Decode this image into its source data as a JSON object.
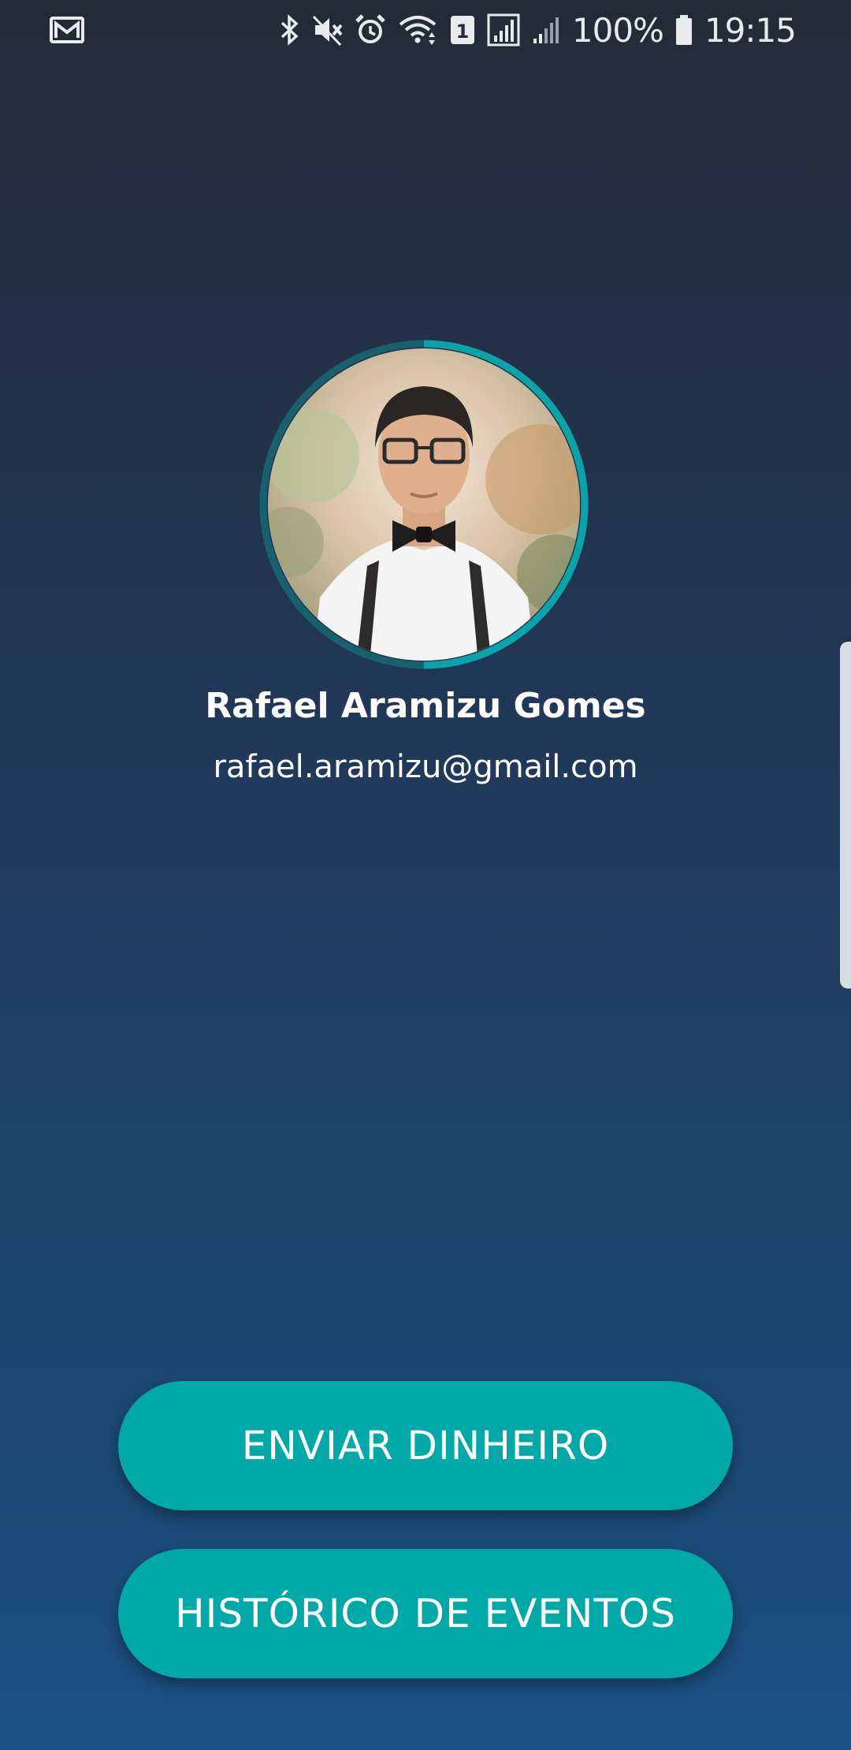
{
  "status_bar": {
    "battery_percent": "100%",
    "time": "19:15",
    "sim_badge": "1",
    "icons": [
      "gmail-notification-icon",
      "bluetooth-icon",
      "mute-icon",
      "alarm-icon",
      "wifi-icon",
      "sim-1-icon",
      "signal-icon",
      "signal-2-icon",
      "battery-icon"
    ]
  },
  "profile": {
    "name": "Rafael Aramizu Gomes",
    "email": "rafael.aramizu@gmail.com",
    "progress_ring_fraction": 0.5,
    "ring_color": "#0aa3a8"
  },
  "actions": {
    "send_money_label": "ENVIAR DINHEIRO",
    "history_label": "HISTÓRICO DE EVENTOS"
  },
  "colors": {
    "button": "#00a8a8",
    "background_top": "#252a37",
    "background_bottom": "#1a5082"
  }
}
